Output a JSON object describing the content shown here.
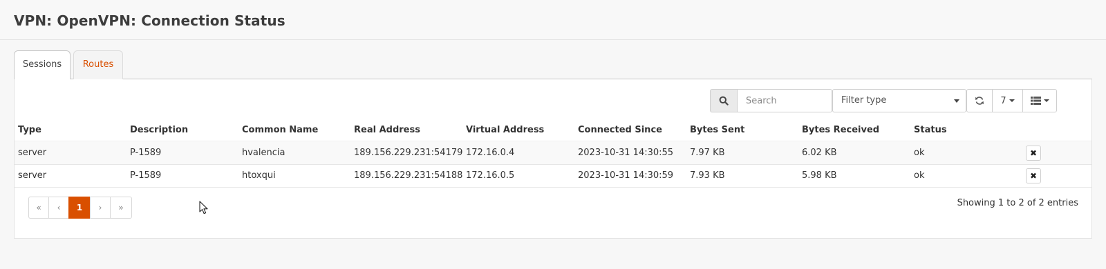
{
  "page": {
    "title": "VPN: OpenVPN: Connection Status"
  },
  "tabs": [
    {
      "label": "Sessions",
      "active": true
    },
    {
      "label": "Routes",
      "active": false
    }
  ],
  "toolbar": {
    "search_placeholder": "Search",
    "search_value": "",
    "filter_type": "Filter type",
    "rows_per_page": "7",
    "icons": {
      "search": "search-icon",
      "refresh": "refresh-icon",
      "columns": "list-columns-icon"
    }
  },
  "table": {
    "columns": [
      "Type",
      "Description",
      "Common Name",
      "Real Address",
      "Virtual Address",
      "Connected Since",
      "Bytes Sent",
      "Bytes Received",
      "Status"
    ],
    "rows": [
      [
        "server",
        "P-1589",
        "hvalencia",
        "189.156.229.231:54179",
        "172.16.0.4",
        "2023-10-31 14:30:55",
        "7.97 KB",
        "6.02 KB",
        "ok"
      ],
      [
        "server",
        "P-1589",
        "htoxqui",
        "189.156.229.231:54188",
        "172.16.0.5",
        "2023-10-31 14:30:59",
        "7.93 KB",
        "5.98 KB",
        "ok"
      ]
    ],
    "row_action": "kill-session-icon"
  },
  "pagination": {
    "first": "«",
    "prev": "‹",
    "current": "1",
    "next": "›",
    "last": "»",
    "info": "Showing 1 to 2 of 2 entries"
  },
  "colors": {
    "accent": "#d94f00",
    "header_bg": "#f8f8f8",
    "page_bg": "#f7f7f7"
  }
}
